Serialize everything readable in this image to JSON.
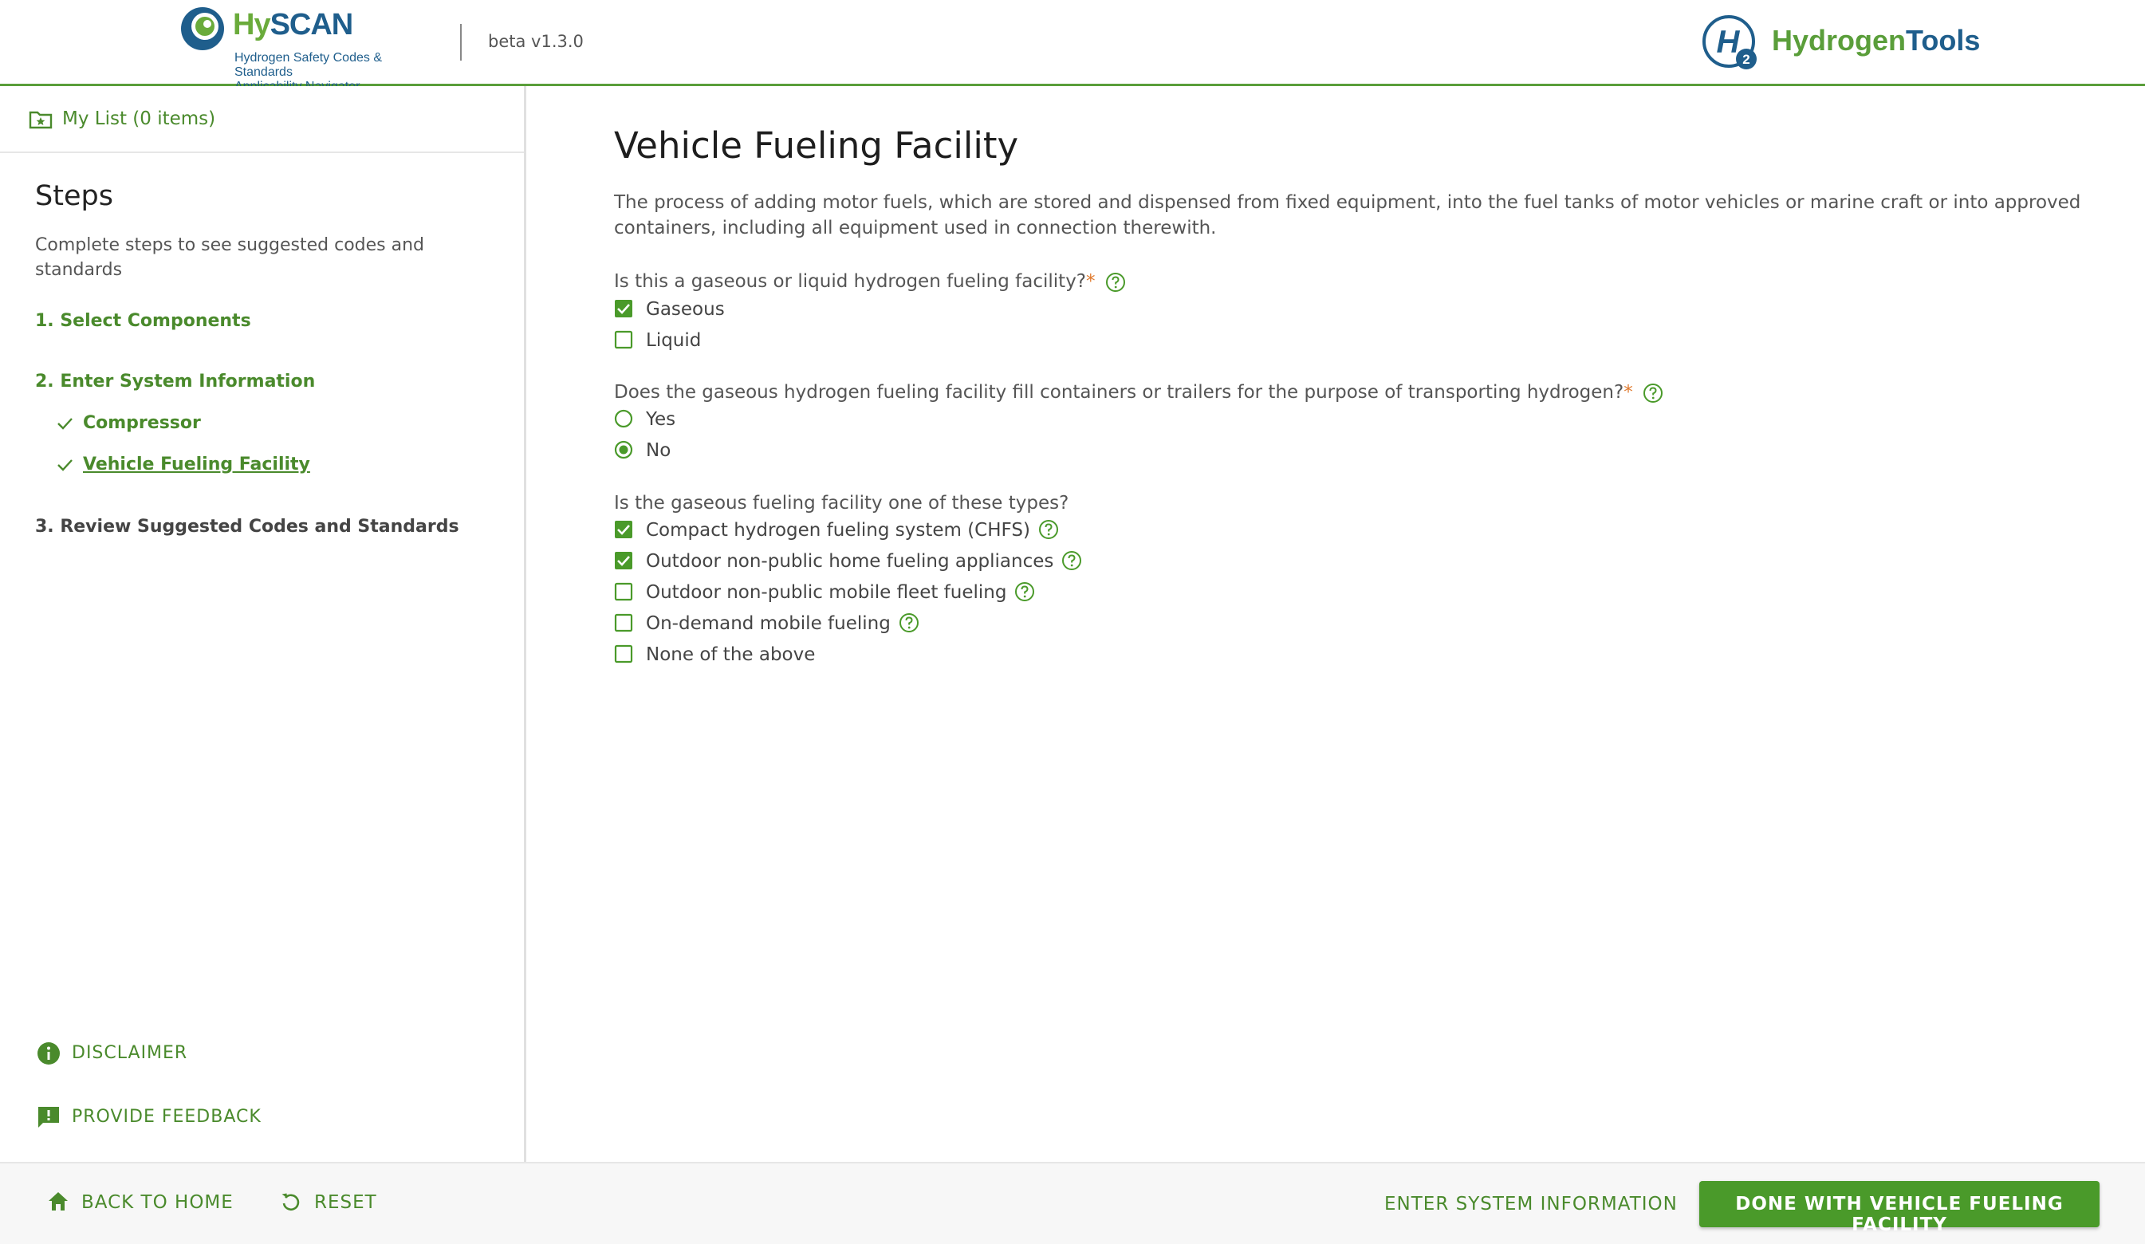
{
  "header": {
    "logo_hy": "Hy",
    "logo_scan": "SCAN",
    "logo_sub1": "Hydrogen Safety Codes & Standards",
    "logo_sub2": "Applicability Navigator",
    "version": "beta v1.3.0",
    "partner_logo_a": "Hydrogen",
    "partner_logo_b": "Tools",
    "partner_logo_sub": "2"
  },
  "sidebar": {
    "my_list": "My List (0 items)",
    "steps_title": "Steps",
    "steps_desc": "Complete steps to see suggested codes and standards",
    "step1": "1. Select Components",
    "step2": "2. Enter System Information",
    "substeps": [
      {
        "label": "Compressor"
      },
      {
        "label": "Vehicle Fueling Facility"
      }
    ],
    "step3": "3. Review Suggested Codes and Standards",
    "disclaimer": "DISCLAIMER",
    "feedback": "PROVIDE FEEDBACK"
  },
  "main": {
    "title": "Vehicle Fueling Facility",
    "description": "The process of adding motor fuels, which are stored and dispensed from fixed equipment, into the fuel tanks of motor vehicles or marine craft or into approved containers, including all equipment used in connection therewith.",
    "q1": {
      "text": "Is this a gaseous or liquid hydrogen fueling facility?",
      "required": "*",
      "options": [
        {
          "label": "Gaseous",
          "checked": true
        },
        {
          "label": "Liquid",
          "checked": false
        }
      ]
    },
    "q2": {
      "text": "Does the gaseous hydrogen fueling facility fill containers or trailers for the purpose of transporting hydrogen?",
      "required": "*",
      "options": [
        {
          "label": "Yes",
          "selected": false
        },
        {
          "label": "No",
          "selected": true
        }
      ]
    },
    "q3": {
      "text": "Is the gaseous fueling facility one of these types?",
      "options": [
        {
          "label": "Compact hydrogen fueling system (CHFS)",
          "checked": true
        },
        {
          "label": "Outdoor non-public home fueling appliances",
          "checked": true
        },
        {
          "label": "Outdoor non-public mobile fleet fueling",
          "checked": false
        },
        {
          "label": "On-demand mobile fueling",
          "checked": false
        },
        {
          "label": "None of the above",
          "checked": false
        }
      ]
    }
  },
  "footer": {
    "back_home": "BACK TO HOME",
    "reset": "RESET",
    "enter_system": "ENTER SYSTEM INFORMATION",
    "done": "DONE WITH VEHICLE FUELING FACILITY"
  },
  "colors": {
    "accent_green": "#4a9a2a",
    "brand_blue": "#1f5e8c",
    "required_orange": "#e07a2e"
  },
  "icons": [
    "hyscan-logo-icon",
    "h2-logo-icon",
    "folder-star-icon",
    "check-icon",
    "info-icon",
    "feedback-icon",
    "help-icon",
    "home-icon",
    "reset-icon",
    "checkbox-icon",
    "radio-icon"
  ]
}
